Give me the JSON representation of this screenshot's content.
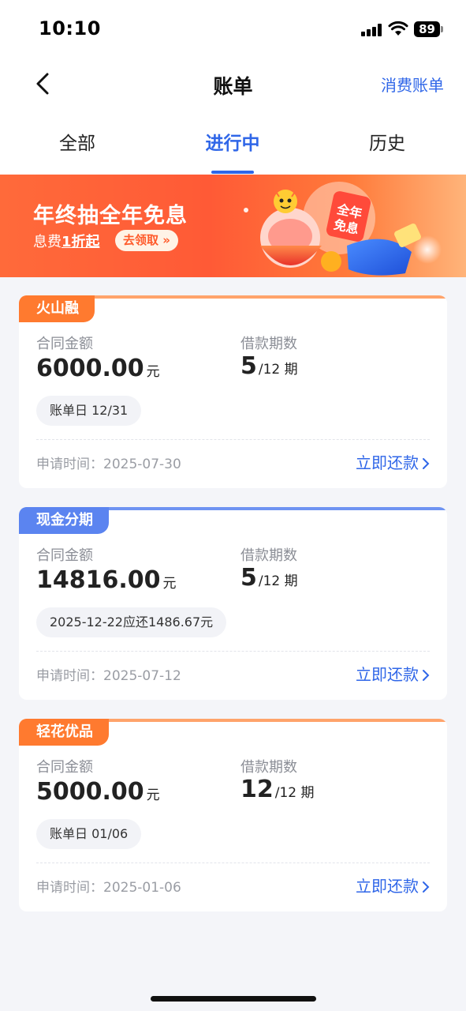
{
  "status": {
    "time": "10:10",
    "battery": "89"
  },
  "nav": {
    "title": "账单",
    "right_link": "消费账单"
  },
  "tabs": [
    {
      "label": "全部"
    },
    {
      "label": "进行中"
    },
    {
      "label": "历史"
    }
  ],
  "banner": {
    "title": "年终抽全年免息",
    "subtitle_prefix": "息费",
    "subtitle_emph": "1折起",
    "button": "去领取",
    "badge_line1": "全年",
    "badge_line2": "免息"
  },
  "colors": {
    "accent": "#2f66e8",
    "orange": "#ff7a2f",
    "blue_tag": "#5b84f0"
  },
  "loans": [
    {
      "tag": "火山融",
      "amount_label": "合同金额",
      "amount": "6000.00",
      "amount_unit": "元",
      "period_label": "借款期数",
      "period_current": "5",
      "period_total": "/12 期",
      "pill": "账单日 12/31",
      "apply_time": "申请时间：2025-07-30",
      "action": "立即还款"
    },
    {
      "tag": "现金分期",
      "amount_label": "合同金额",
      "amount": "14816.00",
      "amount_unit": "元",
      "period_label": "借款期数",
      "period_current": "5",
      "period_total": "/12 期",
      "pill": "2025-12-22应还1486.67元",
      "apply_time": "申请时间：2025-07-12",
      "action": "立即还款"
    },
    {
      "tag": "轻花优品",
      "amount_label": "合同金额",
      "amount": "5000.00",
      "amount_unit": "元",
      "period_label": "借款期数",
      "period_current": "12",
      "period_total": "/12 期",
      "pill": "账单日 01/06",
      "apply_time": "申请时间：2025-01-06",
      "action": "立即还款"
    }
  ]
}
